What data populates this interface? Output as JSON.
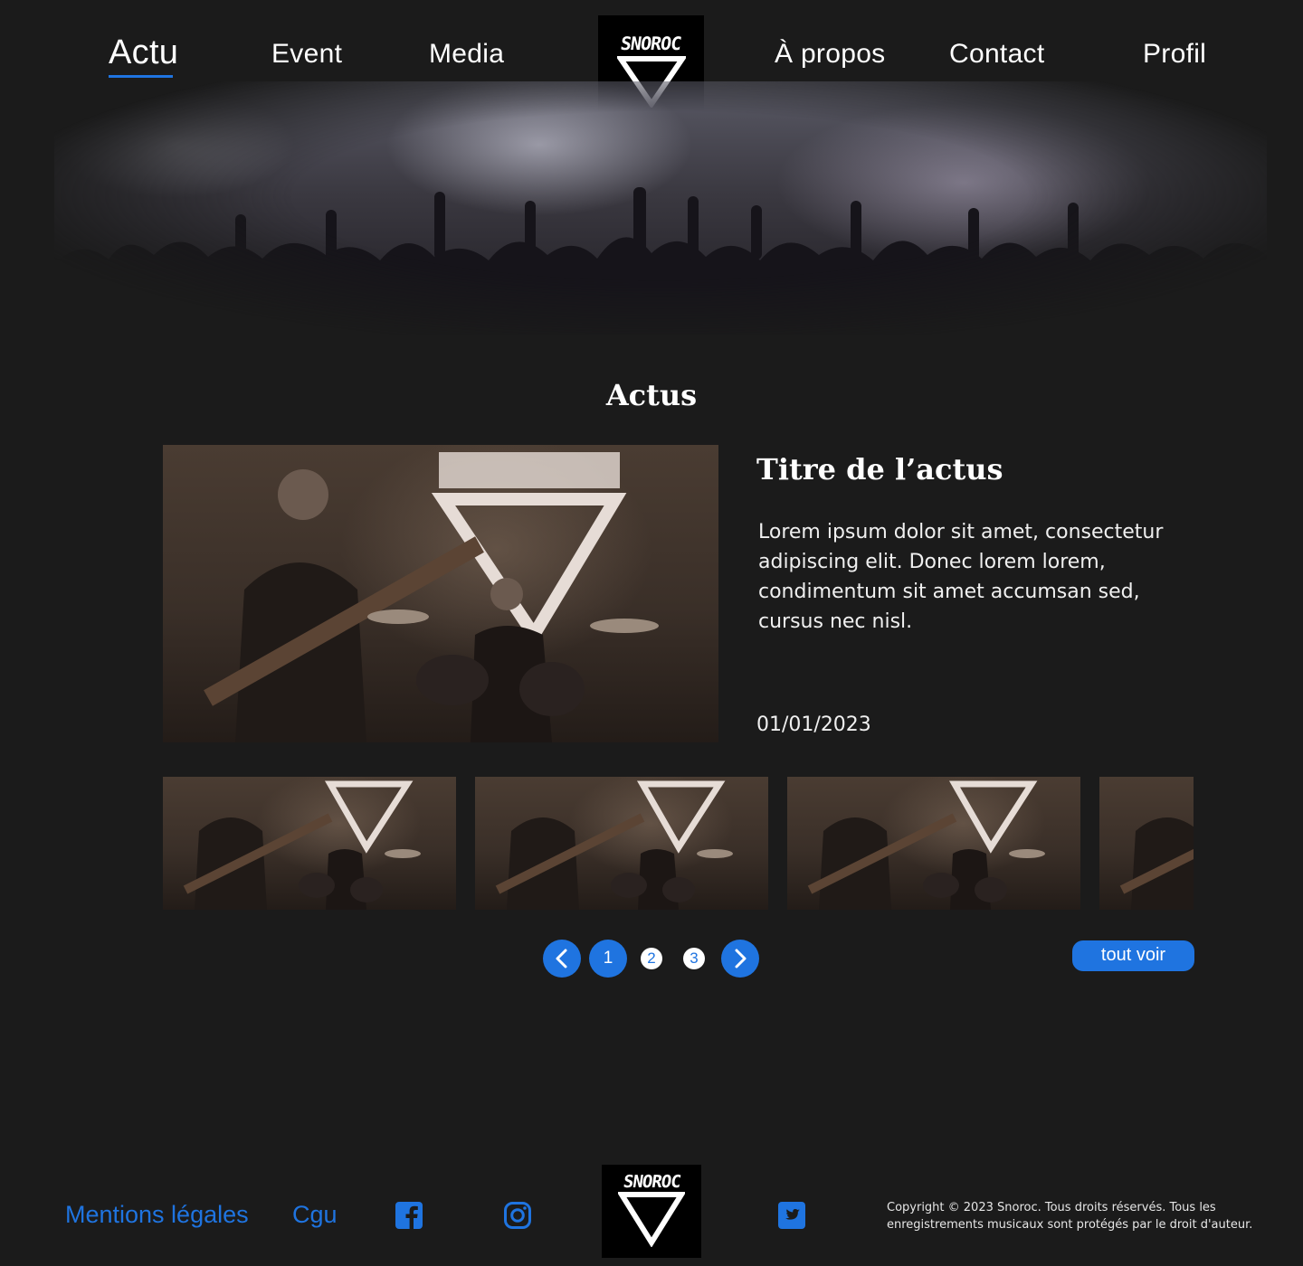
{
  "colors": {
    "background": "#1b1b1b",
    "accent": "#1f74e0",
    "text": "#ffffff"
  },
  "nav": {
    "items": [
      {
        "label": "Actu",
        "active": true
      },
      {
        "label": "Event"
      },
      {
        "label": "Media"
      },
      {
        "label": "À propos"
      },
      {
        "label": "Contact"
      },
      {
        "label": "Profil"
      }
    ],
    "logo_text": "SNOROC"
  },
  "section": {
    "title": "Actus"
  },
  "featured": {
    "title": "Titre de l’actus",
    "body": "Lorem ipsum dolor sit amet, consectetur adipiscing elit. Donec lorem lorem, condimentum sit amet accumsan sed, cursus nec nisl.",
    "date": "01/01/2023"
  },
  "pagination": {
    "pages": [
      "1",
      "2",
      "3"
    ],
    "current": "1",
    "prev_icon": "chevron-left-icon",
    "next_icon": "chevron-right-icon"
  },
  "all_button": "tout voir",
  "footer": {
    "links": [
      "Mentions légales",
      "Cgu"
    ],
    "social_icons": [
      "facebook-icon",
      "instagram-icon",
      "twitter-icon"
    ],
    "logo_text": "SNOROC",
    "copyright": "Copyright © 2023 Snoroc. Tous droits réservés. Tous les enregistrements musicaux sont protégés par le droit d'auteur."
  }
}
